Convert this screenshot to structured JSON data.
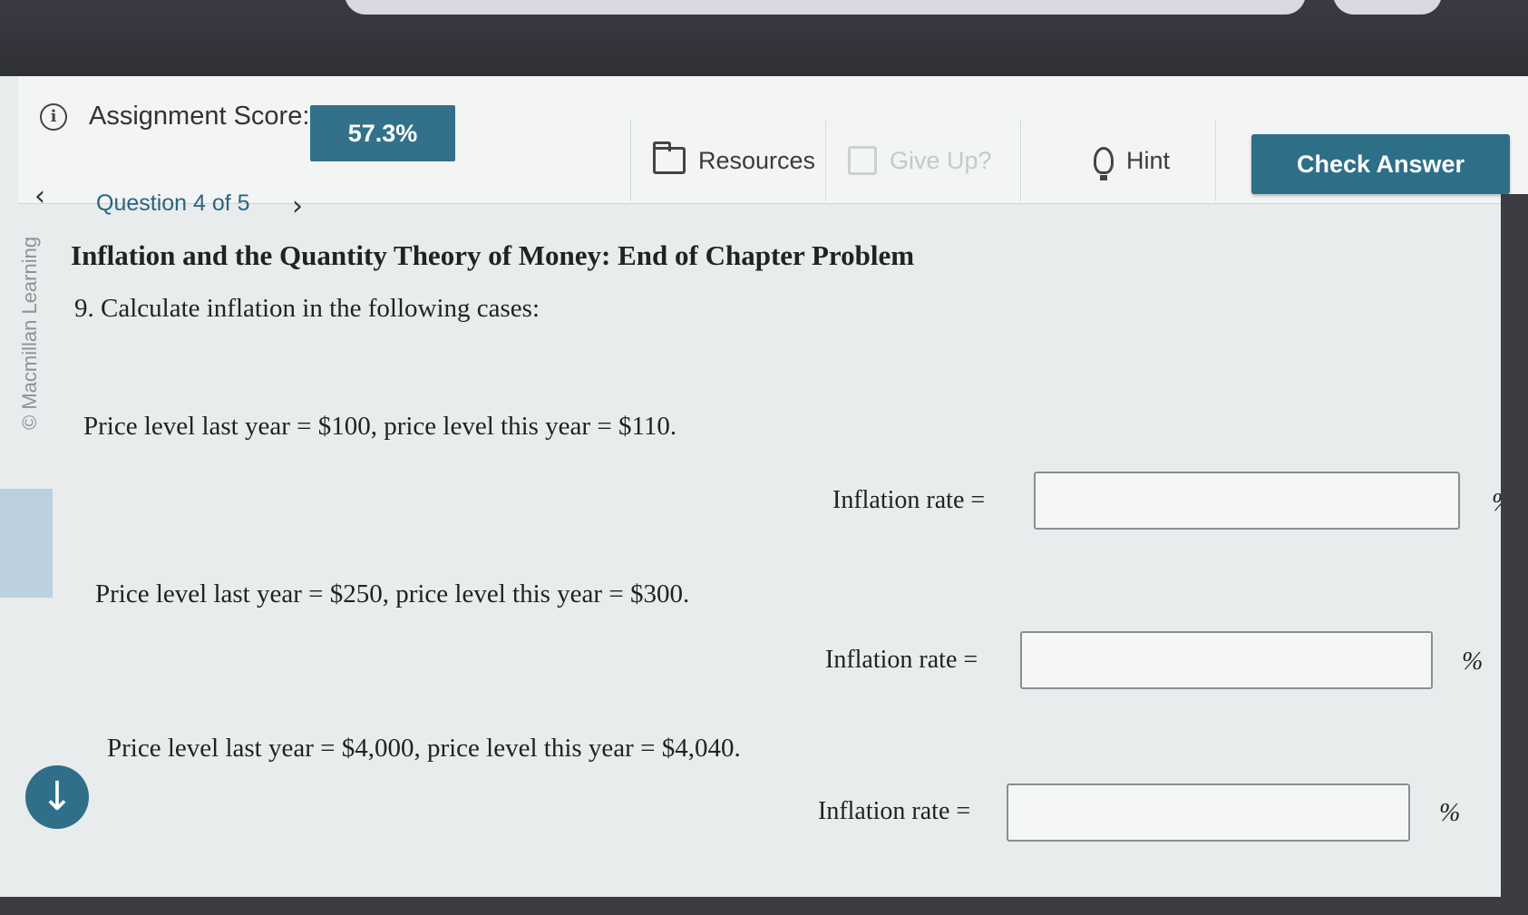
{
  "header": {
    "score_label": "Assignment Score:",
    "score_value": "57.3%",
    "resources_label": "Resources",
    "give_up_label": "Give Up?",
    "hint_label": "Hint",
    "check_answer_label": "Check Answer"
  },
  "nav": {
    "prev_icon": "chevron-left-icon",
    "question_label": "Question 4 of 5",
    "next_icon": "chevron-right-icon"
  },
  "watermark": "© Macmillan Learning",
  "question": {
    "title": "Inflation and the Quantity Theory of Money: End of Chapter Problem",
    "prompt": "9. Calculate inflation in the following cases:",
    "cases": [
      {
        "text": "Price level last year = $100, price level this year = $110.",
        "rate_label": "Inflation rate =",
        "value": "",
        "unit": "%"
      },
      {
        "text": "Price level last year = $250, price level this year = $300.",
        "rate_label": "Inflation rate =",
        "value": "",
        "unit": "%"
      },
      {
        "text": "Price level last year = $4,000, price level this year = $4,040.",
        "rate_label": "Inflation rate =",
        "value": "",
        "unit": "%"
      }
    ]
  },
  "colors": {
    "accent": "#2e6f88",
    "link": "#2b6580"
  }
}
